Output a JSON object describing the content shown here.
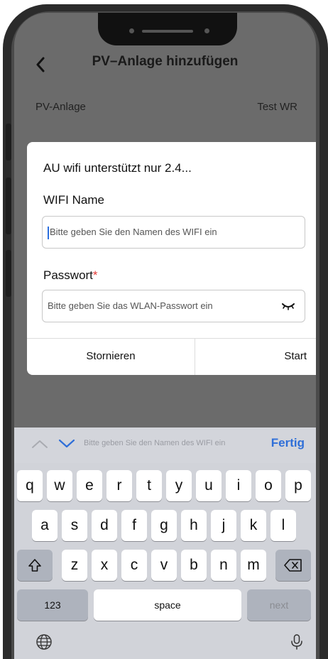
{
  "header": {
    "back": "<",
    "title": "PV–Anlage hinzufügen"
  },
  "row": {
    "label": "PV-Anlage",
    "value": "Test WR"
  },
  "dialog": {
    "heading": "AU wifi unterstützt nur 2.4...",
    "wifi_label": "WIFI Name",
    "wifi_placeholder": "Bitte geben Sie den Namen des WIFI ein",
    "password_label": "Passwort",
    "password_required_mark": "*",
    "password_placeholder": "Bitte geben Sie das WLAN-Passwort ein",
    "cancel_label": "Stornieren",
    "start_label": "Start"
  },
  "accessory": {
    "hint": "Bitte geben Sie den Namen des WIFI ein",
    "done_label": "Fertig",
    "accent_color": "#2f6fd8"
  },
  "keyboard": {
    "row1": [
      "q",
      "w",
      "e",
      "r",
      "t",
      "y",
      "u",
      "i",
      "o",
      "p"
    ],
    "row2": [
      "a",
      "s",
      "d",
      "f",
      "g",
      "h",
      "j",
      "k",
      "l"
    ],
    "row3": [
      "z",
      "x",
      "c",
      "v",
      "b",
      "n",
      "m"
    ],
    "numbers_label": "123",
    "space_label": "space",
    "next_label": "next",
    "shift_icon": "shift-icon",
    "backspace_icon": "backspace-icon",
    "globe_icon": "globe-icon",
    "mic_icon": "microphone-icon"
  }
}
